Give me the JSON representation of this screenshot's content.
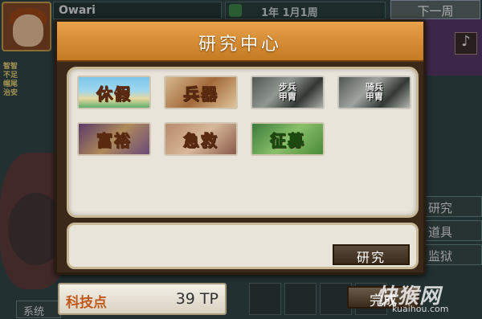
{
  "game": {
    "player_name": "Owari",
    "date_text": "1年  1月1周",
    "next_week_label": "下一周",
    "side_stats": [
      "智智",
      "不足",
      "帽尾",
      "治安"
    ],
    "right_menu": [
      "研究",
      "道具",
      "监狱"
    ],
    "system_label": "系统"
  },
  "dialog": {
    "title": "研究中心",
    "tiles": [
      {
        "label": "休假",
        "locked": false
      },
      {
        "label": "兵器",
        "locked": false
      },
      {
        "label": "步兵甲胄",
        "locked": true
      },
      {
        "label": "骑兵甲胄",
        "locked": true
      },
      {
        "label": "富裕",
        "locked": false
      },
      {
        "label": "急救",
        "locked": false
      },
      {
        "label": "征募",
        "locked": false
      }
    ],
    "research_button": "研究"
  },
  "footer": {
    "points_label": "科技点",
    "points_value": "39 TP",
    "done_button": "完成"
  },
  "watermark": {
    "main": "快猴网",
    "sub": "kuaihou.com"
  },
  "colors": {
    "header_orange": "#d88a2e",
    "panel_beige": "#e9e4da",
    "points_orange": "#c0581a"
  }
}
